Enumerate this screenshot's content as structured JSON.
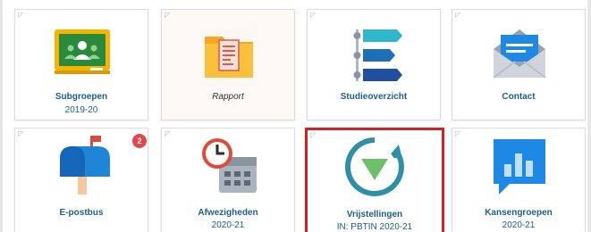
{
  "tiles": [
    {
      "label": "Subgroepen",
      "sublabel": "2019-20",
      "icon": "google-classroom-icon"
    },
    {
      "label": "Rapport",
      "sublabel": "",
      "icon": "report-folder-icon"
    },
    {
      "label": "Studieoverzicht",
      "sublabel": "",
      "icon": "study-overview-icon"
    },
    {
      "label": "Contact",
      "sublabel": "",
      "icon": "envelope-icon"
    },
    {
      "label": "E-postbus",
      "sublabel": "",
      "icon": "mailbox-icon",
      "badge": "2"
    },
    {
      "label": "Afwezigheden",
      "sublabel": "2020-21",
      "icon": "clock-calendar-icon"
    },
    {
      "label": "Vrijstellingen",
      "sublabel": "IN: PBTIN 2020-21",
      "icon": "exemption-icon",
      "selected": true
    },
    {
      "label": "Kansengroepen",
      "sublabel": "2020-21",
      "icon": "chart-bubble-icon"
    }
  ],
  "colors": {
    "label": "#1b5f86",
    "badge": "#e2474d",
    "selection_border": "#d32026"
  }
}
